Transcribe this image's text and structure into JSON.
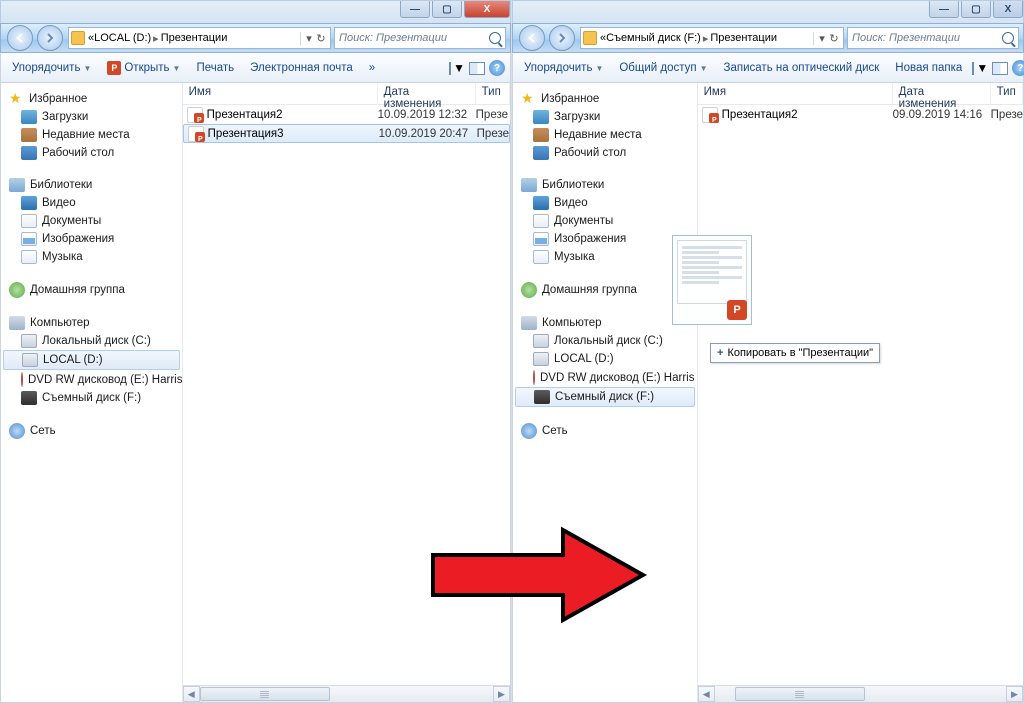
{
  "left": {
    "titlebar": {
      "min": "—",
      "max": "▢",
      "close": "X"
    },
    "address": {
      "prefix": "«",
      "p1": "LOCAL (D:)",
      "p2": "Презентации",
      "search_placeholder": "Поиск: Презентации"
    },
    "toolbar": {
      "organize": "Упорядочить",
      "open": "Открыть",
      "print": "Печать",
      "email": "Электронная почта",
      "more": "»"
    },
    "nav": {
      "favorites": "Избранное",
      "downloads": "Загрузки",
      "recent": "Недавние места",
      "desktop": "Рабочий стол",
      "libraries": "Библиотеки",
      "video": "Видео",
      "documents": "Документы",
      "pictures": "Изображения",
      "music": "Музыка",
      "homegroup": "Домашняя группа",
      "computer": "Компьютер",
      "cdrive": "Локальный диск (C:)",
      "ddrive": "LOCAL (D:)",
      "dvd": "DVD RW дисковод (E:) Harris Docum",
      "fdrive": "Съемный диск (F:)",
      "network": "Сеть"
    },
    "cols": {
      "name": "Имя",
      "date": "Дата изменения",
      "type": "Тип"
    },
    "files": [
      {
        "name": "Презентация2",
        "date": "10.09.2019 12:32",
        "type": "Презе"
      },
      {
        "name": "Презентация3",
        "date": "10.09.2019 20:47",
        "type": "Презе"
      }
    ]
  },
  "right": {
    "titlebar_variant": "close2",
    "address": {
      "prefix": "«",
      "p1": "Съемный диск (F:)",
      "p2": "Презентации",
      "search_placeholder": "Поиск: Презентации"
    },
    "toolbar": {
      "organize": "Упорядочить",
      "share": "Общий доступ",
      "burn": "Записать на оптический диск",
      "newfolder": "Новая папка"
    },
    "nav": {
      "favorites": "Избранное",
      "downloads": "Загрузки",
      "recent": "Недавние места",
      "desktop": "Рабочий стол",
      "libraries": "Библиотеки",
      "video": "Видео",
      "documents": "Документы",
      "pictures": "Изображения",
      "music": "Музыка",
      "homegroup": "Домашняя группа",
      "computer": "Компьютер",
      "cdrive": "Локальный диск (C:)",
      "ddrive": "LOCAL (D:)",
      "dvd": "DVD RW дисковод (E:) Harris Docu",
      "fdrive": "Съемный диск (F:)",
      "network": "Сеть"
    },
    "cols": {
      "name": "Имя",
      "date": "Дата изменения",
      "type": "Тип"
    },
    "files": [
      {
        "name": "Презентация2",
        "date": "09.09.2019 14:16",
        "type": "Презе"
      }
    ],
    "drag_tooltip": "Копировать в \"Презентации\"",
    "drag_plus": "+"
  }
}
